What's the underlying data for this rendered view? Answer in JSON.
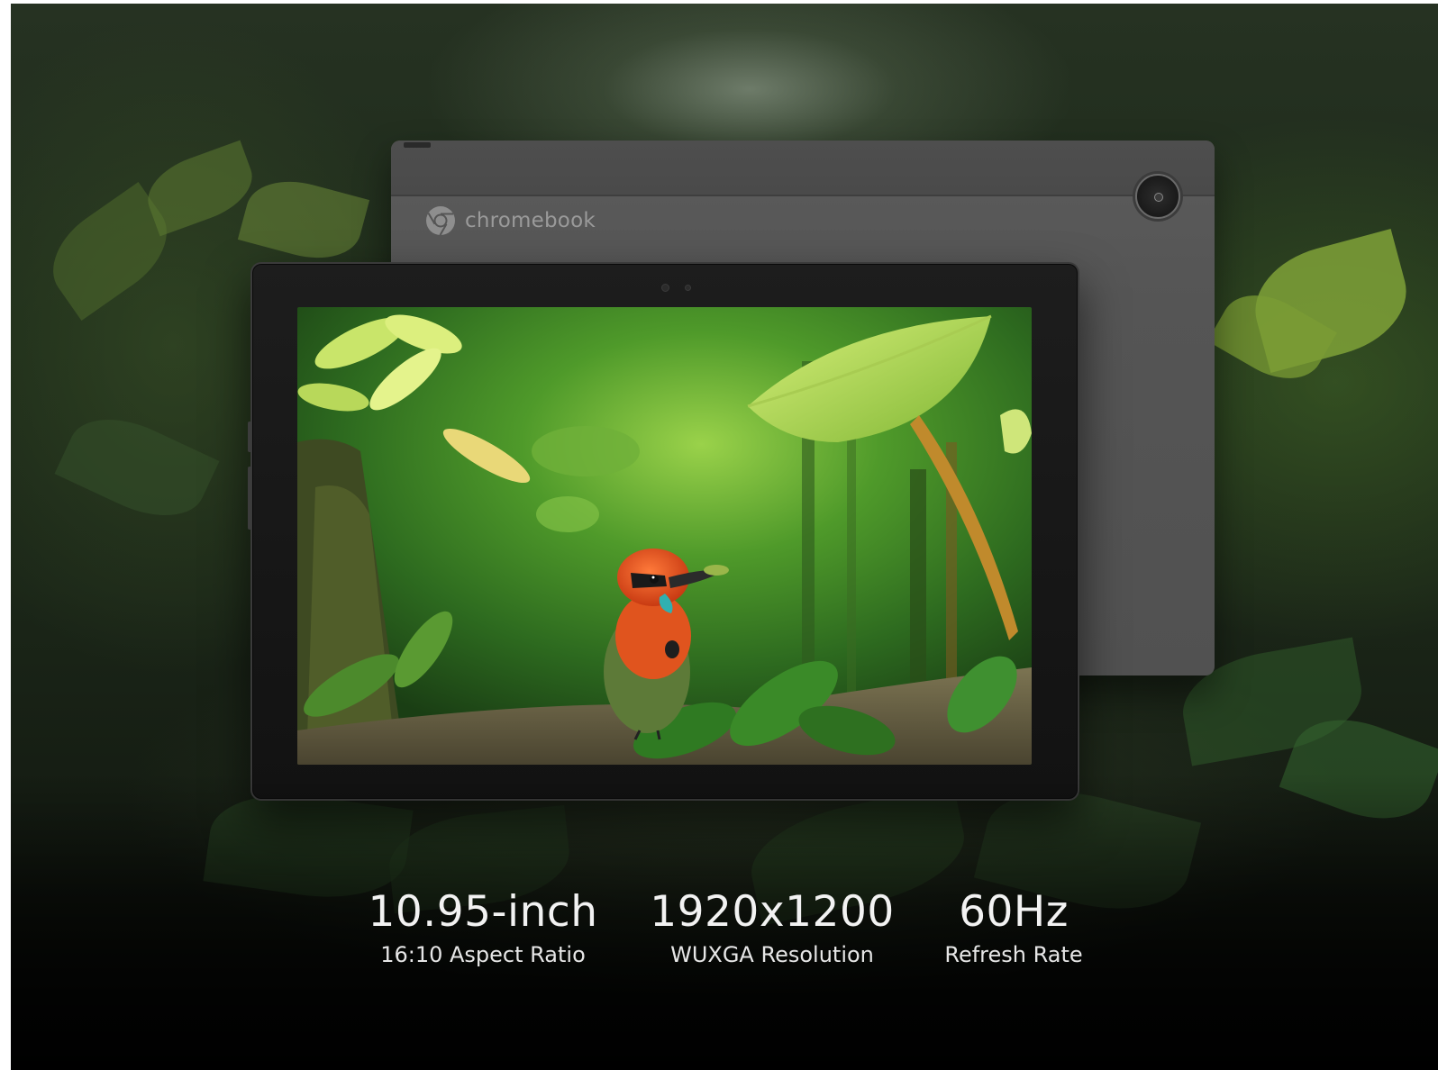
{
  "product": {
    "brand_text": "chromebook",
    "brand_logo_icon": "chrome-logo-icon",
    "screen_image_subject": "forest-bird-wallpaper"
  },
  "specs": [
    {
      "value": "10.95-inch",
      "label": "16:10 Aspect Ratio"
    },
    {
      "value": "1920x1200",
      "label": "WUXGA Resolution"
    },
    {
      "value": "60Hz",
      "label": "Refresh Rate"
    }
  ],
  "colors": {
    "text_primary": "#f2f2f2",
    "tablet_back": "#555555",
    "tablet_bezel": "#141414",
    "foliage_green": "#5a8f2a"
  }
}
